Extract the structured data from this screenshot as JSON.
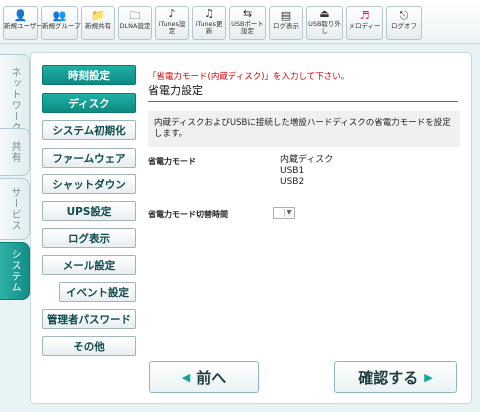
{
  "toolbar": {
    "buttons": [
      {
        "label": "新規ユーザー",
        "icon": "new-user-icon",
        "glyph": "👤"
      },
      {
        "label": "新規グループ",
        "icon": "new-group-icon",
        "glyph": "👥"
      },
      {
        "label": "新規共有",
        "icon": "new-share-folder-icon",
        "glyph": "📁"
      },
      {
        "label": "DLNA設定",
        "icon": "dlna-settings-icon",
        "glyph": "🗀"
      },
      {
        "label": "iTunes設定",
        "icon": "itunes-settings-icon",
        "glyph": "♪"
      },
      {
        "label": "iTunes更新",
        "icon": "itunes-update-icon",
        "glyph": "♫"
      },
      {
        "label": "USBポート設定",
        "icon": "usb-port-icon",
        "glyph": "⇆"
      },
      {
        "label": "ログ表示",
        "icon": "log-view-icon",
        "glyph": "▤"
      },
      {
        "label": "USB取り外し",
        "icon": "usb-eject-icon",
        "glyph": "⏏"
      },
      {
        "label": "メロディー",
        "icon": "melody-icon",
        "glyph": "♬"
      },
      {
        "label": "ログオフ",
        "icon": "logoff-icon",
        "glyph": "⎋"
      }
    ]
  },
  "side_tabs": [
    {
      "label": "ネットワーク",
      "active": false
    },
    {
      "label": "共有",
      "active": false
    },
    {
      "label": "サービス",
      "active": false
    },
    {
      "label": "システム",
      "active": true
    }
  ],
  "menu": [
    {
      "label": "時刻設定",
      "selected": true
    },
    {
      "label": "ディスク",
      "selected": true
    },
    {
      "label": "システム初期化",
      "selected": false
    },
    {
      "label": "ファームウェア",
      "selected": false
    },
    {
      "label": "シャットダウン",
      "selected": false
    },
    {
      "label": "UPS設定",
      "selected": false
    },
    {
      "label": "ログ表示",
      "selected": false
    },
    {
      "label": "メール設定",
      "selected": false
    },
    {
      "label": "イベント設定",
      "selected": false
    },
    {
      "label": "管理者パスワード",
      "selected": false
    },
    {
      "label": "その他",
      "selected": false
    }
  ],
  "content": {
    "instruction": "「省電力モード(内蔵ディスク)」を入力して下さい。",
    "title": "省電力設定",
    "description": "内蔵ディスクおよびUSBに接続した増設ハードディスクの省電力モードを設定します。",
    "power_mode_label": "省電力モード",
    "power_mode_options": [
      "内蔵ディスク",
      "USB1",
      "USB2"
    ],
    "switch_time_label": "省電力モード切替時間",
    "switch_time_value": ""
  },
  "nav": {
    "prev_label": "前へ",
    "confirm_label": "確認する"
  },
  "colors": {
    "accent": "#12a59b",
    "warning_text": "#d40000",
    "page_background": "#e8f3f6"
  }
}
